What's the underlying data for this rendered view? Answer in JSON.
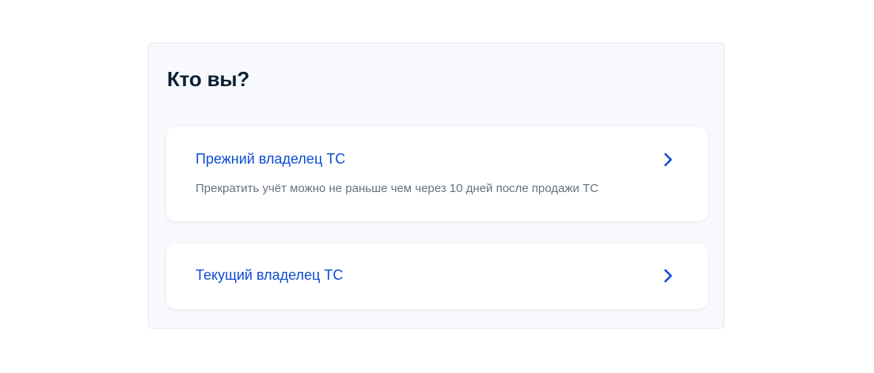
{
  "page": {
    "title": "Кто вы?"
  },
  "options": [
    {
      "label": "Прежний владелец ТС",
      "description": "Прекратить учёт можно не раньше чем через 10 дней после продажи ТС",
      "icon": "chevron-right-icon"
    },
    {
      "label": "Текущий владелец ТС",
      "icon": "chevron-right-icon"
    }
  ],
  "colors": {
    "accent": "#0d4cd3",
    "title": "#0b1f33",
    "secondary_text": "#66727f",
    "panel_background": "#f7f9fc",
    "card_background": "#ffffff"
  }
}
